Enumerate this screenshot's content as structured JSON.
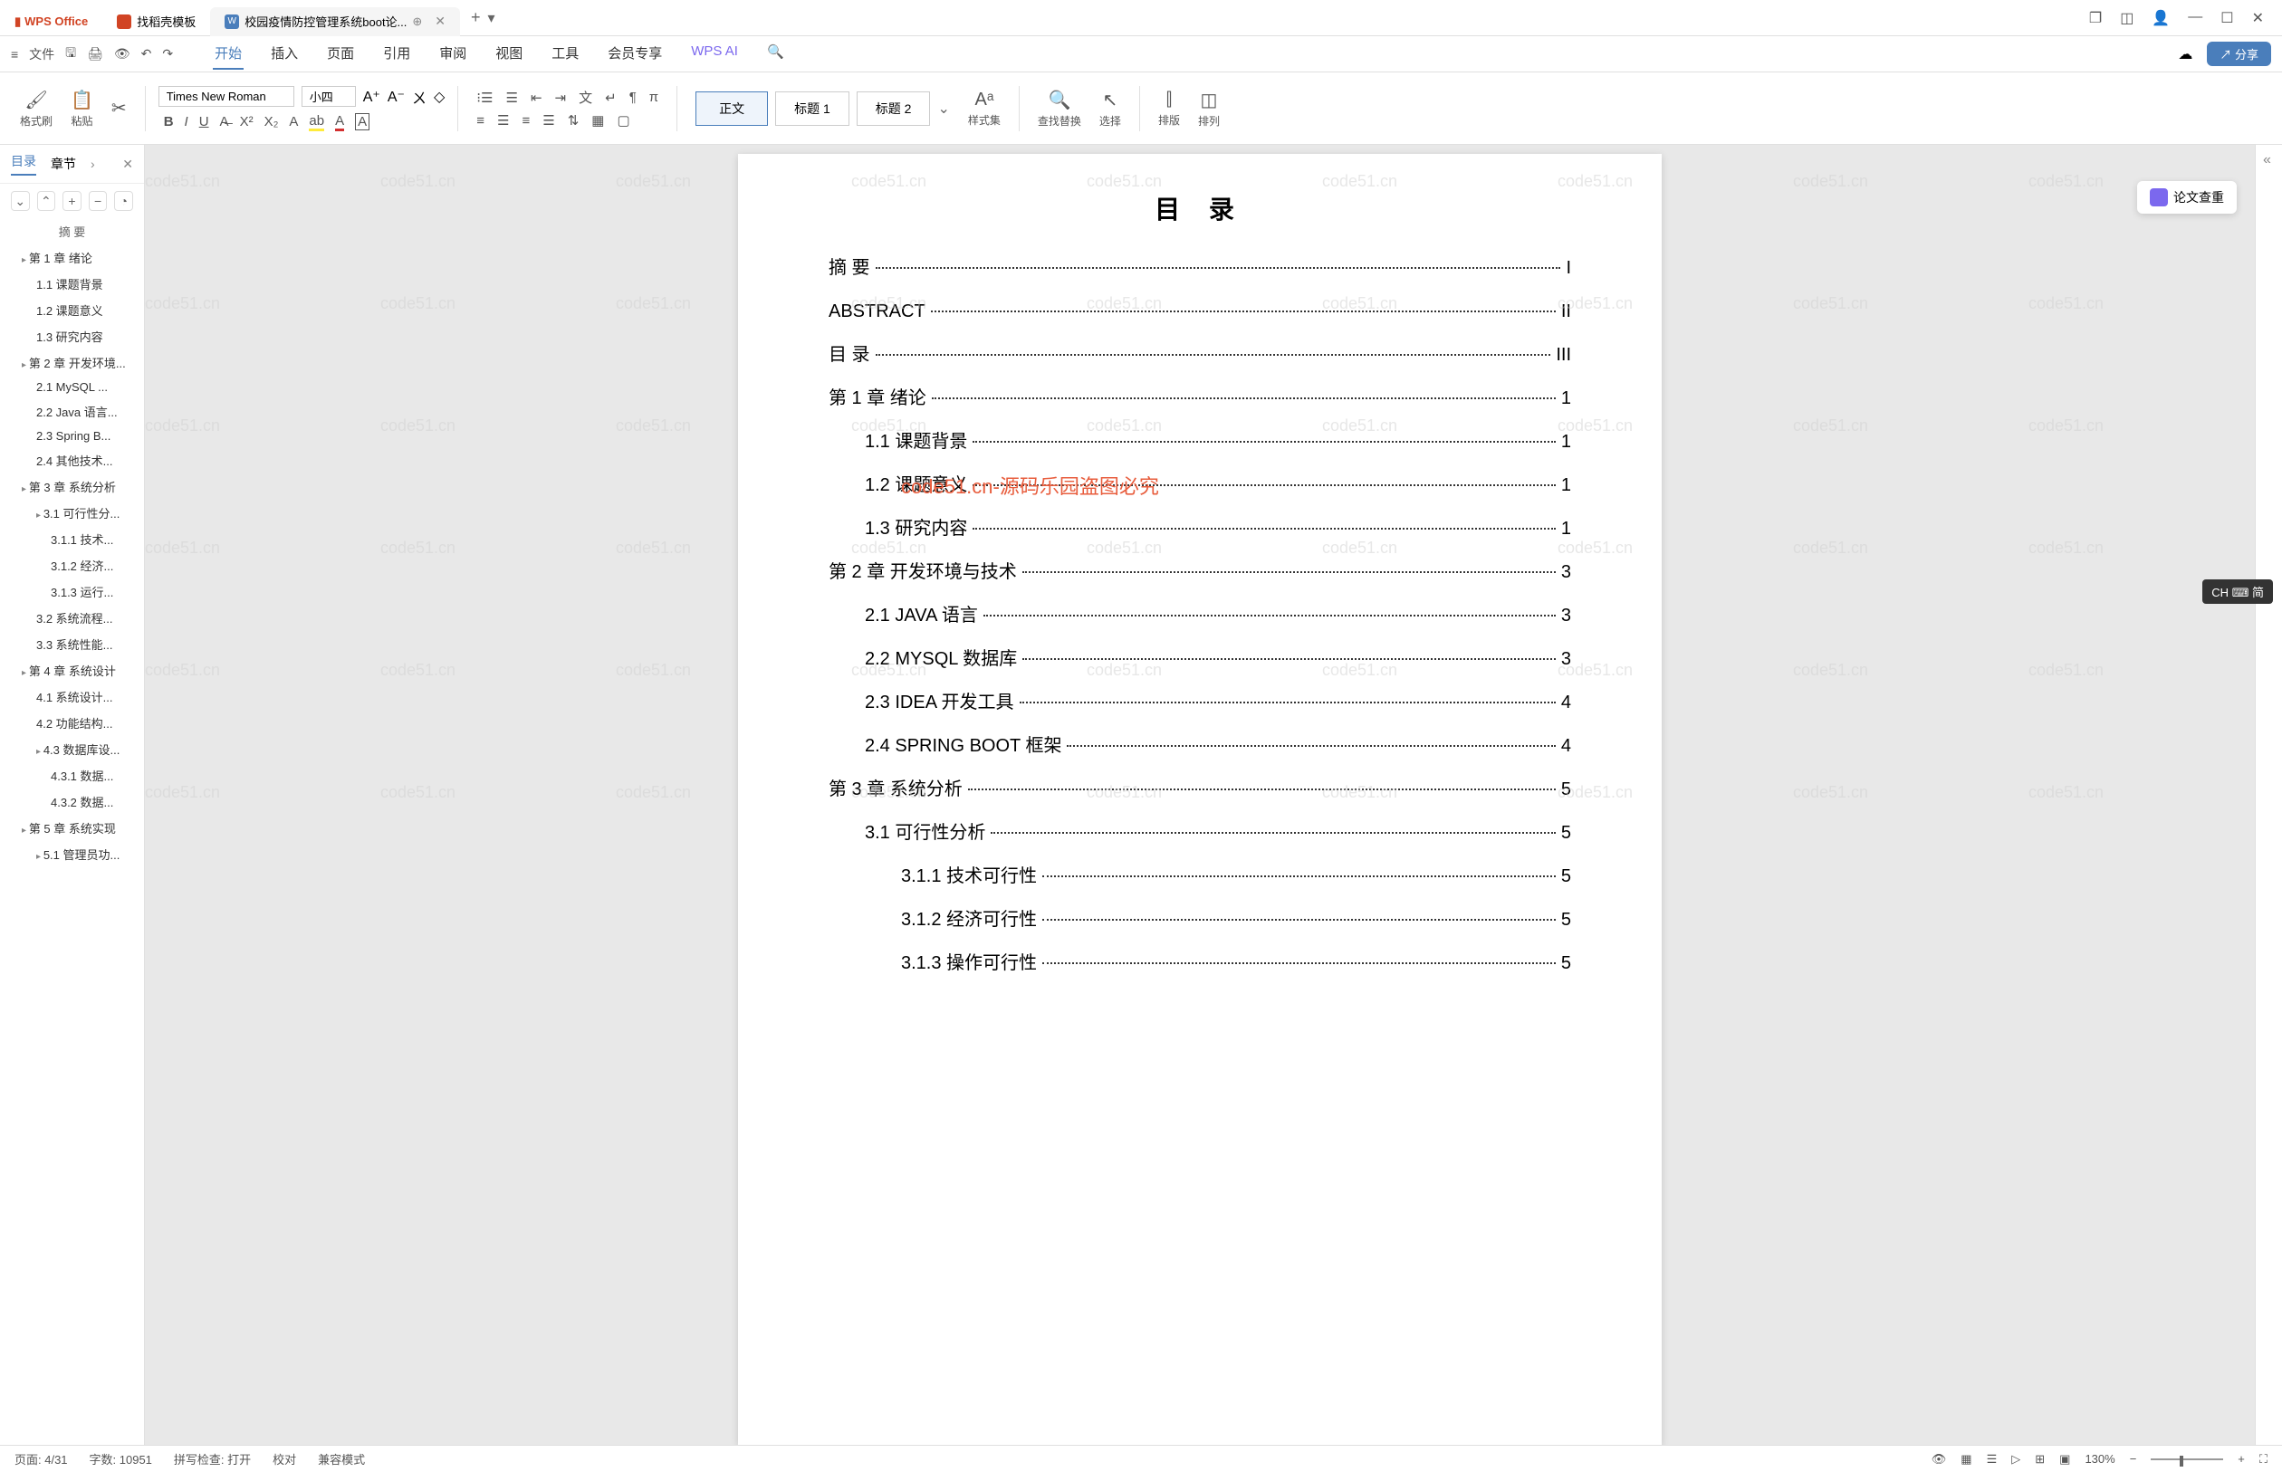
{
  "app": {
    "name": "WPS Office"
  },
  "tabs": [
    {
      "label": "找稻壳模板",
      "icon": "#d14424"
    },
    {
      "label": "校园疫情防控管理系统boot论...",
      "icon": "#4a7ebb",
      "active": true
    }
  ],
  "menus": {
    "file": "文件",
    "items": [
      "开始",
      "插入",
      "页面",
      "引用",
      "审阅",
      "视图",
      "工具",
      "会员专享"
    ],
    "active": "开始",
    "ai": "WPS AI",
    "share": "分享"
  },
  "ribbon": {
    "format_brush": "格式刷",
    "paste": "粘贴",
    "font_name": "Times New Roman",
    "font_size": "小四",
    "styles": {
      "normal": "正文",
      "h1": "标题 1",
      "h2": "标题 2"
    },
    "styleset": "样式集",
    "findreplace": "查找替换",
    "select": "选择",
    "sort": "排版",
    "arrange": "排列"
  },
  "sidebar": {
    "tab_toc": "目录",
    "tab_chapter": "章节",
    "items": [
      {
        "t": "摘  要",
        "l": 0
      },
      {
        "t": "第 1 章  绪论",
        "l": 1,
        "h": true
      },
      {
        "t": "1.1  课题背景",
        "l": 2
      },
      {
        "t": "1.2  课题意义",
        "l": 2
      },
      {
        "t": "1.3  研究内容",
        "l": 2
      },
      {
        "t": "第 2 章  开发环境...",
        "l": 1,
        "h": true
      },
      {
        "t": "2.1 MySQL ...",
        "l": 2
      },
      {
        "t": "2.2 Java 语言...",
        "l": 2
      },
      {
        "t": "2.3 Spring B...",
        "l": 2
      },
      {
        "t": "2.4 其他技术...",
        "l": 2
      },
      {
        "t": "第 3 章  系统分析",
        "l": 1,
        "h": true
      },
      {
        "t": "3.1 可行性分...",
        "l": 2,
        "h": true
      },
      {
        "t": "3.1.1 技术...",
        "l": 3
      },
      {
        "t": "3.1.2 经济...",
        "l": 3
      },
      {
        "t": "3.1.3 运行...",
        "l": 3
      },
      {
        "t": "3.2 系统流程...",
        "l": 2
      },
      {
        "t": "3.3 系统性能...",
        "l": 2
      },
      {
        "t": "第 4 章  系统设计",
        "l": 1,
        "h": true
      },
      {
        "t": "4.1 系统设计...",
        "l": 2
      },
      {
        "t": "4.2 功能结构...",
        "l": 2
      },
      {
        "t": "4.3 数据库设...",
        "l": 2,
        "h": true
      },
      {
        "t": "4.3.1 数据...",
        "l": 3
      },
      {
        "t": "4.3.2 数据...",
        "l": 3
      },
      {
        "t": "第 5 章  系统实现",
        "l": 1,
        "h": true
      },
      {
        "t": "5.1 管理员功...",
        "l": 2,
        "h": true
      }
    ]
  },
  "doc": {
    "title": "目  录",
    "lines": [
      {
        "t": "摘  要",
        "p": "I",
        "l": 1
      },
      {
        "t": "ABSTRACT",
        "p": "II",
        "l": 1
      },
      {
        "t": "目  录",
        "p": "III",
        "l": 1
      },
      {
        "t": "第 1 章  绪论",
        "p": "1",
        "l": 1
      },
      {
        "t": "1.1  课题背景",
        "p": "1",
        "l": 2
      },
      {
        "t": "1.2  课题意义",
        "p": "1",
        "l": 2
      },
      {
        "t": "1.3  研究内容",
        "p": "1",
        "l": 2
      },
      {
        "t": "第 2 章  开发环境与技术",
        "p": "3",
        "l": 1
      },
      {
        "t": "2.1 JAVA 语言",
        "p": "3",
        "l": 2,
        "sc": true
      },
      {
        "t": "2.2 MYSQL 数据库",
        "p": "3",
        "l": 2
      },
      {
        "t": "2.3 IDEA 开发工具",
        "p": "4",
        "l": 2
      },
      {
        "t": "2.4 SPRING BOOT 框架",
        "p": "4",
        "l": 2,
        "sc": true
      },
      {
        "t": "第 3 章  系统分析",
        "p": "5",
        "l": 1
      },
      {
        "t": "3.1  可行性分析",
        "p": "5",
        "l": 2
      },
      {
        "t": "3.1.1  技术可行性",
        "p": "5",
        "l": 3
      },
      {
        "t": "3.1.2  经济可行性",
        "p": "5",
        "l": 3
      },
      {
        "t": "3.1.3  操作可行性",
        "p": "5",
        "l": 3
      }
    ]
  },
  "watermark": {
    "main": "code51.cn-源码乐园盗图必究",
    "bg": "code51.cn"
  },
  "float": {
    "label": "论文查重"
  },
  "ime": "CH ⌨ 简",
  "status": {
    "page": "页面: 4/31",
    "words": "字数: 10951",
    "spell": "拼写检查: 打开",
    "proof": "校对",
    "compat": "兼容模式",
    "zoom": "130%"
  }
}
